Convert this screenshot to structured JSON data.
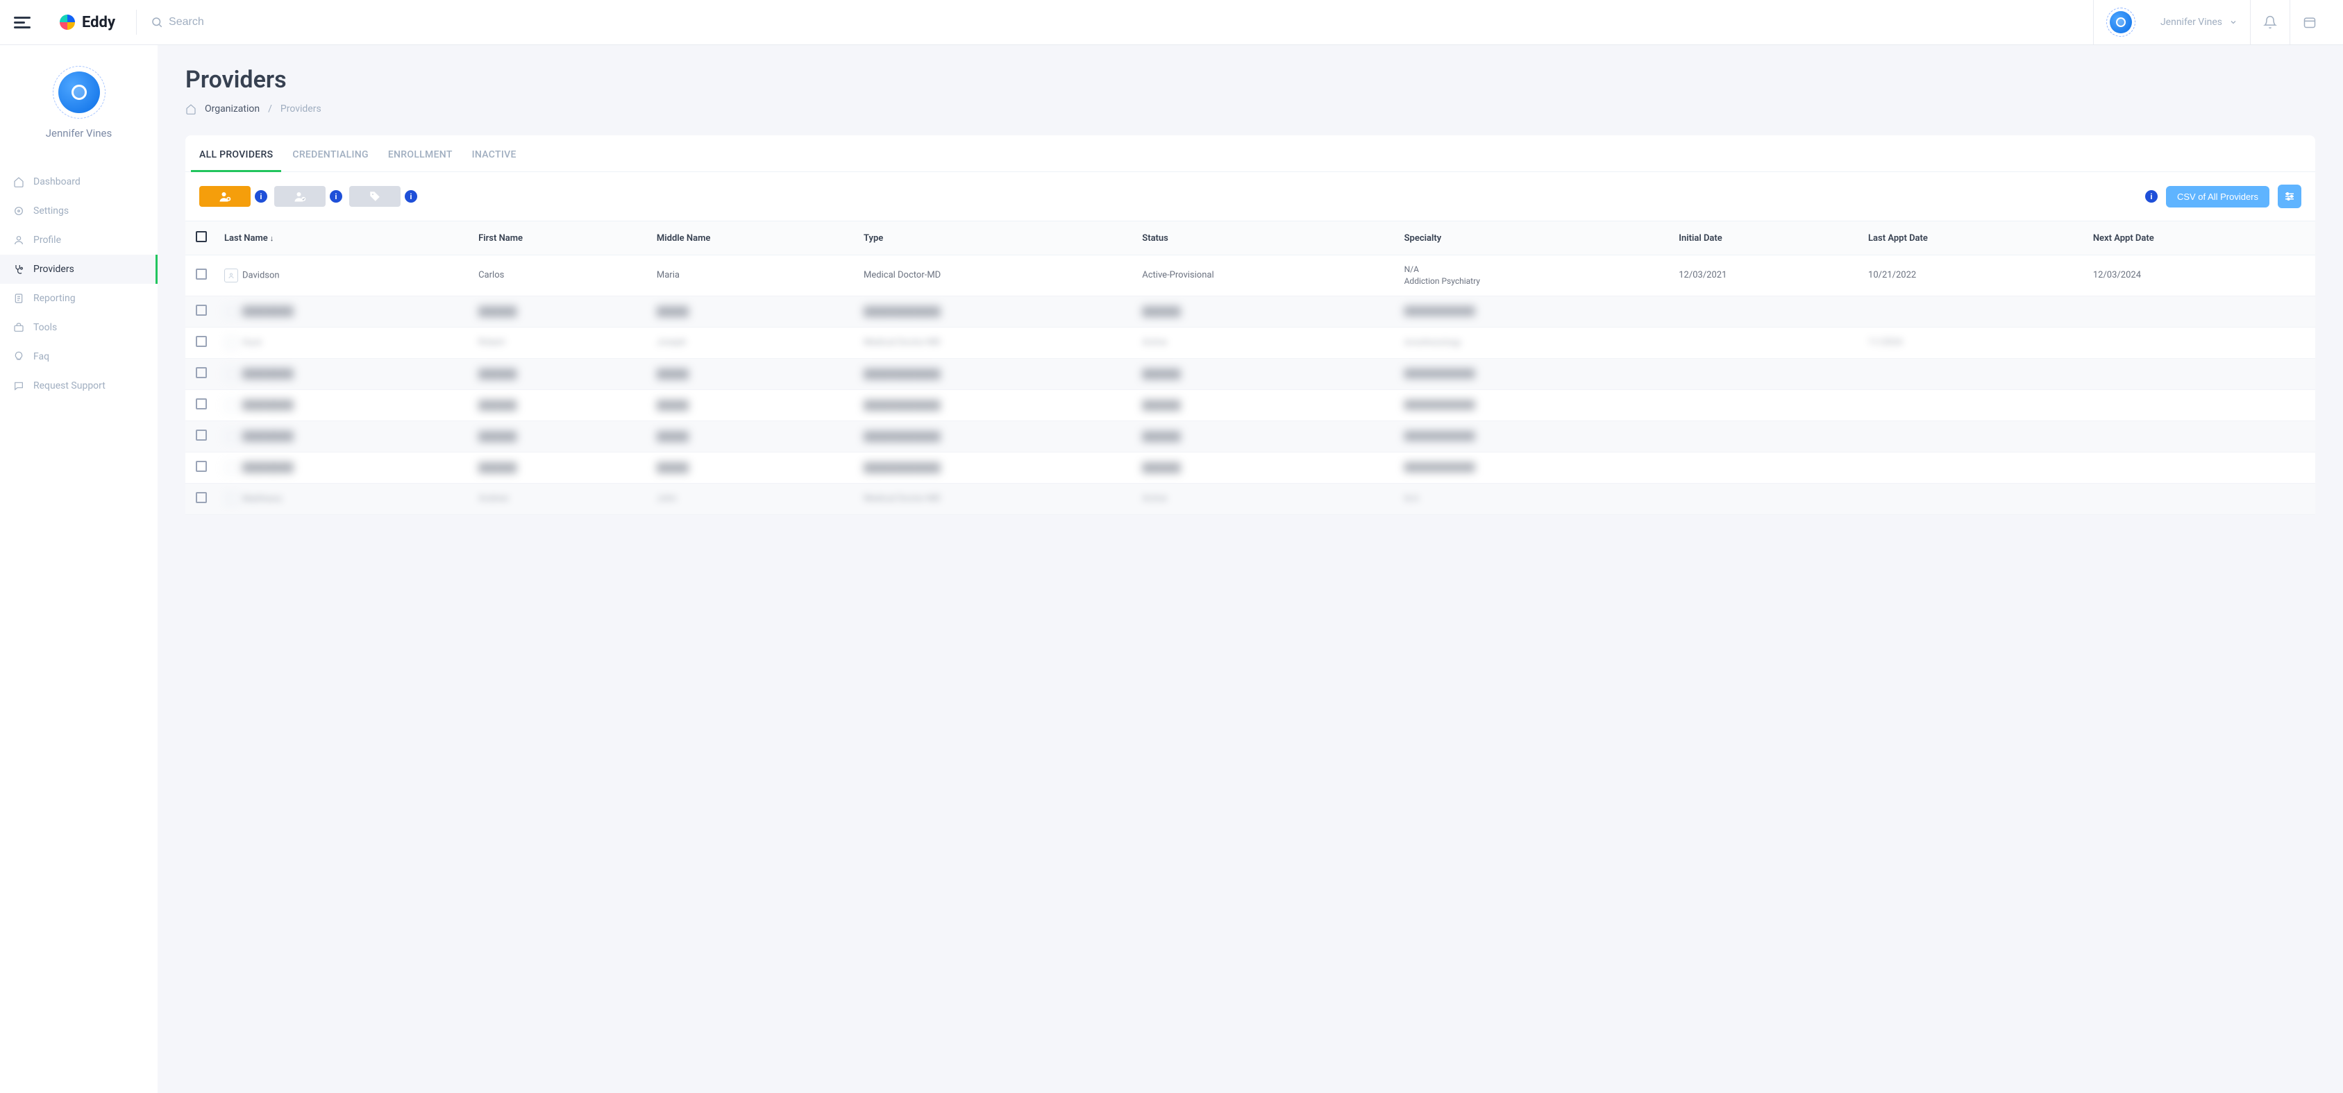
{
  "header": {
    "logo_text": "Eddy",
    "search_placeholder": "Search",
    "user_name": "Jennifer Vines"
  },
  "sidebar": {
    "profile_name": "Jennifer Vines",
    "nav": [
      {
        "label": "Dashboard"
      },
      {
        "label": "Settings"
      },
      {
        "label": "Profile"
      },
      {
        "label": "Providers"
      },
      {
        "label": "Reporting"
      },
      {
        "label": "Tools"
      },
      {
        "label": "Faq"
      },
      {
        "label": "Request Support"
      }
    ]
  },
  "page": {
    "title": "Providers",
    "breadcrumb": {
      "root": "Organization",
      "current": "Providers"
    }
  },
  "tabs": [
    {
      "label": "ALL PROVIDERS",
      "active": true
    },
    {
      "label": "CREDENTIALING"
    },
    {
      "label": "ENROLLMENT"
    },
    {
      "label": "INACTIVE"
    }
  ],
  "toolbar": {
    "csv_button": "CSV of All Providers"
  },
  "table": {
    "columns": {
      "last_name": "Last Name",
      "first_name": "First Name",
      "middle_name": "Middle Name",
      "type": "Type",
      "status": "Status",
      "specialty": "Specialty",
      "initial_date": "Initial Date",
      "last_appt": "Last Appt Date",
      "next_appt": "Next Appt Date"
    },
    "rows": [
      {
        "last_name": "Davidson",
        "first_name": "Carlos",
        "middle_name": "Maria",
        "type": "Medical Doctor-MD",
        "status": "Active-Provisional",
        "specialty_line1": "N/A",
        "specialty_line2": "Addiction Psychiatry",
        "initial_date": "12/03/2021",
        "last_appt": "10/21/2022",
        "next_appt": "12/03/2024",
        "blurred": false
      },
      {
        "blurred": true
      },
      {
        "last_name": "Hunt",
        "first_name": "Robert",
        "middle_name": "Joseph",
        "type": "Medical Doctor-MD",
        "status": "Active",
        "specialty_line1": "Anesthesiology",
        "specialty_line2": "",
        "initial_date": "",
        "last_appt": "11/2024",
        "next_appt": "",
        "blurred": false,
        "semi_blur": true
      },
      {
        "blurred": true
      },
      {
        "blurred": true
      },
      {
        "blurred": true
      },
      {
        "blurred": true
      },
      {
        "last_name": "Matthews",
        "first_name": "Andrew",
        "middle_name": "John",
        "type": "Medical Doctor-MD",
        "status": "Active",
        "specialty_line1": "N/A",
        "specialty_line2": "",
        "initial_date": "",
        "last_appt": "",
        "next_appt": "",
        "blurred": false,
        "semi_blur": true
      }
    ]
  }
}
